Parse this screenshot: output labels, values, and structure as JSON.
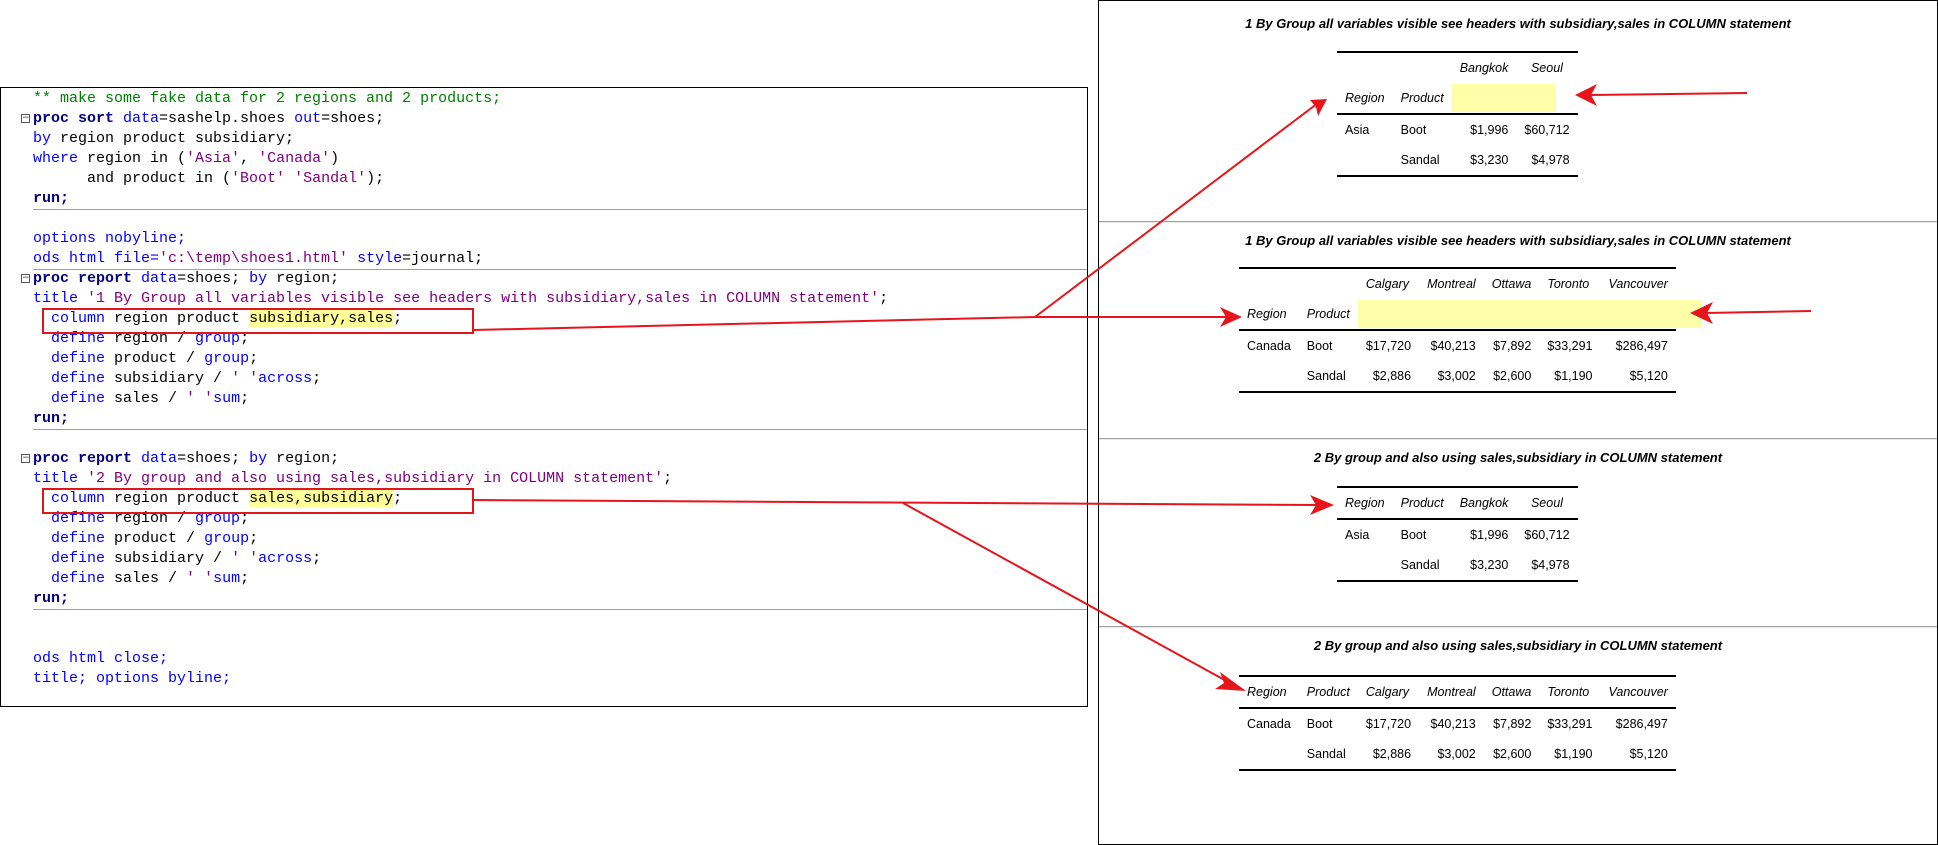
{
  "code_editor": {
    "lines": [
      {
        "segments": [
          {
            "t": "** make some fake data for 2 regions and 2 products;",
            "c": "c-comment"
          }
        ]
      },
      {
        "fold": true,
        "segments": [
          {
            "t": "proc sort",
            "c": "c-kw"
          },
          {
            "t": " "
          },
          {
            "t": "data",
            "c": "c-blue"
          },
          {
            "t": "=sashelp.shoes "
          },
          {
            "t": "out",
            "c": "c-blue"
          },
          {
            "t": "=shoes;"
          }
        ]
      },
      {
        "segments": [
          {
            "t": "by",
            "c": "c-blue"
          },
          {
            "t": " region product subsidiary;"
          }
        ]
      },
      {
        "segments": [
          {
            "t": "where",
            "c": "c-blue"
          },
          {
            "t": " region in ("
          },
          {
            "t": "'Asia'",
            "c": "c-str"
          },
          {
            "t": ", "
          },
          {
            "t": "'Canada'",
            "c": "c-str"
          },
          {
            "t": ")"
          }
        ]
      },
      {
        "segments": [
          {
            "t": "      and product in ("
          },
          {
            "t": "'Boot'",
            "c": "c-str"
          },
          {
            "t": " "
          },
          {
            "t": "'Sandal'",
            "c": "c-str"
          },
          {
            "t": ");"
          }
        ]
      },
      {
        "segments": [
          {
            "t": "run;",
            "c": "c-kw"
          }
        ],
        "sep_after": true
      },
      {
        "segments": []
      },
      {
        "segments": [
          {
            "t": "options nobyline;",
            "c": "c-blue"
          }
        ]
      },
      {
        "segments": [
          {
            "t": "ods html file=",
            "c": "c-blue"
          },
          {
            "t": "'c:\\temp\\shoes1.html'",
            "c": "c-str"
          },
          {
            "t": " "
          },
          {
            "t": "style",
            "c": "c-blue"
          },
          {
            "t": "=journal;"
          }
        ],
        "sep_after": true
      },
      {
        "fold": true,
        "segments": [
          {
            "t": "proc report",
            "c": "c-kw"
          },
          {
            "t": " "
          },
          {
            "t": "data",
            "c": "c-blue"
          },
          {
            "t": "=shoes; "
          },
          {
            "t": "by",
            "c": "c-blue"
          },
          {
            "t": " region;"
          }
        ]
      },
      {
        "segments": [
          {
            "t": "title ",
            "c": "c-blue"
          },
          {
            "t": "'1 By Group all variables visible see headers with subsidiary,sales in COLUMN statement'",
            "c": "c-str"
          },
          {
            "t": ";"
          }
        ]
      },
      {
        "segments": [
          {
            "t": "  "
          },
          {
            "t": "column",
            "c": "c-blue"
          },
          {
            "t": " region product "
          },
          {
            "t": "subsidiary,sales",
            "c": "c-hl"
          },
          {
            "t": ";"
          }
        ]
      },
      {
        "segments": [
          {
            "t": "  "
          },
          {
            "t": "define",
            "c": "c-blue"
          },
          {
            "t": " region / "
          },
          {
            "t": "group",
            "c": "c-blue"
          },
          {
            "t": ";"
          }
        ]
      },
      {
        "segments": [
          {
            "t": "  "
          },
          {
            "t": "define",
            "c": "c-blue"
          },
          {
            "t": " product / "
          },
          {
            "t": "group",
            "c": "c-blue"
          },
          {
            "t": ";"
          }
        ]
      },
      {
        "segments": [
          {
            "t": "  "
          },
          {
            "t": "define",
            "c": "c-blue"
          },
          {
            "t": " subsidiary / "
          },
          {
            "t": "' '",
            "c": "c-str"
          },
          {
            "t": "across",
            "c": "c-blue"
          },
          {
            "t": ";"
          }
        ]
      },
      {
        "segments": [
          {
            "t": "  "
          },
          {
            "t": "define",
            "c": "c-blue"
          },
          {
            "t": " sales / "
          },
          {
            "t": "' '",
            "c": "c-str"
          },
          {
            "t": "sum",
            "c": "c-blue"
          },
          {
            "t": ";"
          }
        ]
      },
      {
        "segments": [
          {
            "t": "run;",
            "c": "c-kw"
          }
        ],
        "sep_after": true
      },
      {
        "segments": []
      },
      {
        "fold": true,
        "segments": [
          {
            "t": "proc report",
            "c": "c-kw"
          },
          {
            "t": " "
          },
          {
            "t": "data",
            "c": "c-blue"
          },
          {
            "t": "=shoes; "
          },
          {
            "t": "by",
            "c": "c-blue"
          },
          {
            "t": " region;"
          }
        ]
      },
      {
        "segments": [
          {
            "t": "title ",
            "c": "c-blue"
          },
          {
            "t": "'2 By group and also using sales,subsidiary in COLUMN statement'",
            "c": "c-str"
          },
          {
            "t": ";"
          }
        ]
      },
      {
        "segments": [
          {
            "t": "  "
          },
          {
            "t": "column",
            "c": "c-blue"
          },
          {
            "t": " region product "
          },
          {
            "t": "sales,subsidiary",
            "c": "c-hl"
          },
          {
            "t": ";"
          }
        ]
      },
      {
        "segments": [
          {
            "t": "  "
          },
          {
            "t": "define",
            "c": "c-blue"
          },
          {
            "t": " region / "
          },
          {
            "t": "group",
            "c": "c-blue"
          },
          {
            "t": ";"
          }
        ]
      },
      {
        "segments": [
          {
            "t": "  "
          },
          {
            "t": "define",
            "c": "c-blue"
          },
          {
            "t": " product / "
          },
          {
            "t": "group",
            "c": "c-blue"
          },
          {
            "t": ";"
          }
        ]
      },
      {
        "segments": [
          {
            "t": "  "
          },
          {
            "t": "define",
            "c": "c-blue"
          },
          {
            "t": " subsidiary / "
          },
          {
            "t": "' '",
            "c": "c-str"
          },
          {
            "t": "across",
            "c": "c-blue"
          },
          {
            "t": ";"
          }
        ]
      },
      {
        "segments": [
          {
            "t": "  "
          },
          {
            "t": "define",
            "c": "c-blue"
          },
          {
            "t": " sales / "
          },
          {
            "t": "' '",
            "c": "c-str"
          },
          {
            "t": "sum",
            "c": "c-blue"
          },
          {
            "t": ";"
          }
        ]
      },
      {
        "segments": [
          {
            "t": "run;",
            "c": "c-kw"
          }
        ],
        "sep_after": true
      },
      {
        "segments": []
      },
      {
        "segments": []
      },
      {
        "segments": [
          {
            "t": "ods html close;",
            "c": "c-blue"
          }
        ]
      },
      {
        "segments": [
          {
            "t": "title; options byline;",
            "c": "c-blue"
          }
        ]
      }
    ]
  },
  "output": {
    "reports": [
      {
        "title": "1 By Group all variables visible see headers with subsidiary,sales in COLUMN statement",
        "layout": "two-row-header",
        "region_header": "Region",
        "product_header": "Product",
        "subsidiaries": [
          "Bangkok",
          "Seoul"
        ],
        "rows": [
          {
            "region": "Asia",
            "product": "Boot",
            "values": [
              "$1,996",
              "$60,712"
            ]
          },
          {
            "region": "",
            "product": "Sandal",
            "values": [
              "$3,230",
              "$4,978"
            ]
          }
        ]
      },
      {
        "title": "1 By Group all variables visible see headers with subsidiary,sales in COLUMN statement",
        "layout": "two-row-header",
        "region_header": "Region",
        "product_header": "Product",
        "subsidiaries": [
          "Calgary",
          "Montreal",
          "Ottawa",
          "Toronto",
          "Vancouver"
        ],
        "rows": [
          {
            "region": "Canada",
            "product": "Boot",
            "values": [
              "$17,720",
              "$40,213",
              "$7,892",
              "$33,291",
              "$286,497"
            ]
          },
          {
            "region": "",
            "product": "Sandal",
            "values": [
              "$2,886",
              "$3,002",
              "$2,600",
              "$1,190",
              "$5,120"
            ]
          }
        ]
      },
      {
        "title": "2 By group and also using sales,subsidiary in COLUMN statement",
        "layout": "one-row-header",
        "region_header": "Region",
        "product_header": "Product",
        "subsidiaries": [
          "Bangkok",
          "Seoul"
        ],
        "rows": [
          {
            "region": "Asia",
            "product": "Boot",
            "values": [
              "$1,996",
              "$60,712"
            ]
          },
          {
            "region": "",
            "product": "Sandal",
            "values": [
              "$3,230",
              "$4,978"
            ]
          }
        ]
      },
      {
        "title": "2 By group and also using sales,subsidiary in COLUMN statement",
        "layout": "one-row-header",
        "region_header": "Region",
        "product_header": "Product",
        "subsidiaries": [
          "Calgary",
          "Montreal",
          "Ottawa",
          "Toronto",
          "Vancouver"
        ],
        "rows": [
          {
            "region": "Canada",
            "product": "Boot",
            "values": [
              "$17,720",
              "$40,213",
              "$7,892",
              "$33,291",
              "$286,497"
            ]
          },
          {
            "region": "",
            "product": "Sandal",
            "values": [
              "$2,886",
              "$3,002",
              "$2,600",
              "$1,190",
              "$5,120"
            ]
          }
        ]
      }
    ]
  },
  "colors": {
    "annotation_red": "#e8141b",
    "highlight_yellow": "#ffffaa"
  }
}
